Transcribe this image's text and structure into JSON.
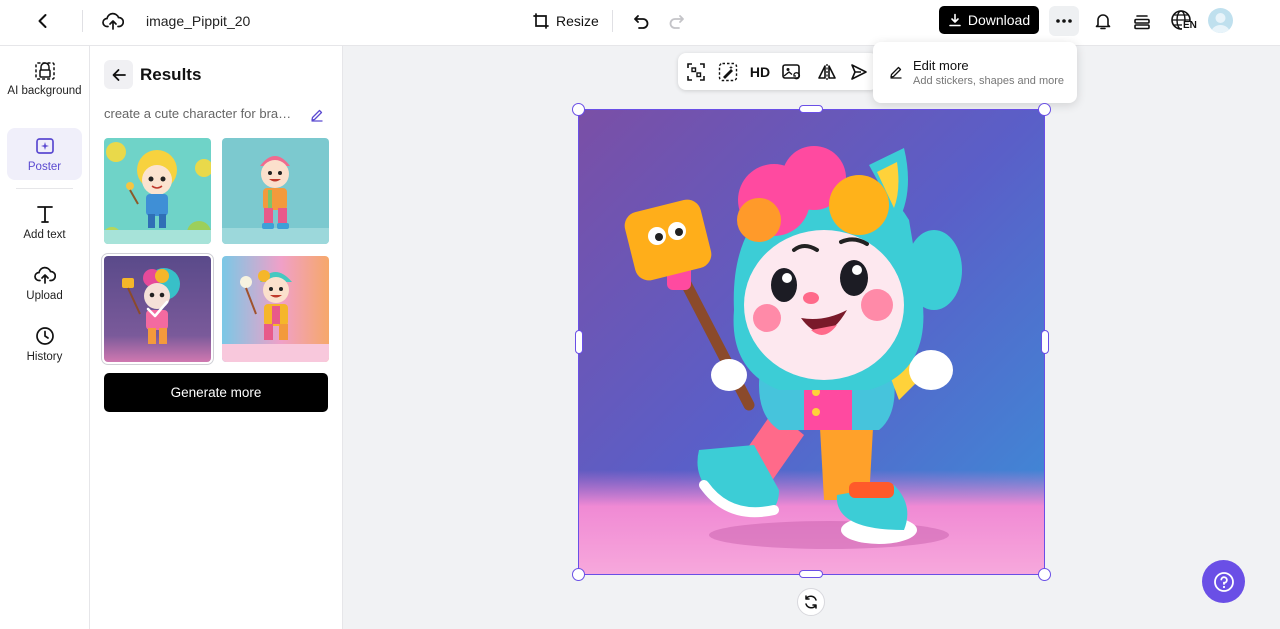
{
  "header": {
    "filename": "image_Pippit_20",
    "resize_label": "Resize",
    "download_label": "Download",
    "language_badge": "EN"
  },
  "rail": {
    "items": [
      {
        "label": "AI background",
        "icon": "ai-background-icon"
      },
      {
        "label": "Poster",
        "icon": "poster-icon",
        "active": true
      },
      {
        "label": "Add text",
        "icon": "text-icon"
      },
      {
        "label": "Upload",
        "icon": "upload-icon"
      },
      {
        "label": "History",
        "icon": "history-icon"
      }
    ]
  },
  "results": {
    "title": "Results",
    "prompt": "create a cute character for brand mascot",
    "generate_label": "Generate more",
    "thumbnails": [
      {
        "bg": "#6fd3c8",
        "selected": false
      },
      {
        "bg": "#7cc9cf",
        "selected": false
      },
      {
        "bg": "#6b4b8f",
        "selected": true
      },
      {
        "bg": "#f4a0b8",
        "selected": false
      }
    ]
  },
  "toolbar": {
    "hd_label": "HD"
  },
  "popover": {
    "title": "Edit more",
    "subtitle": "Add stickers, shapes and more"
  },
  "colors": {
    "accent": "#6a4fe6",
    "active_bg": "#f0effa",
    "dark_button": "#000000"
  }
}
